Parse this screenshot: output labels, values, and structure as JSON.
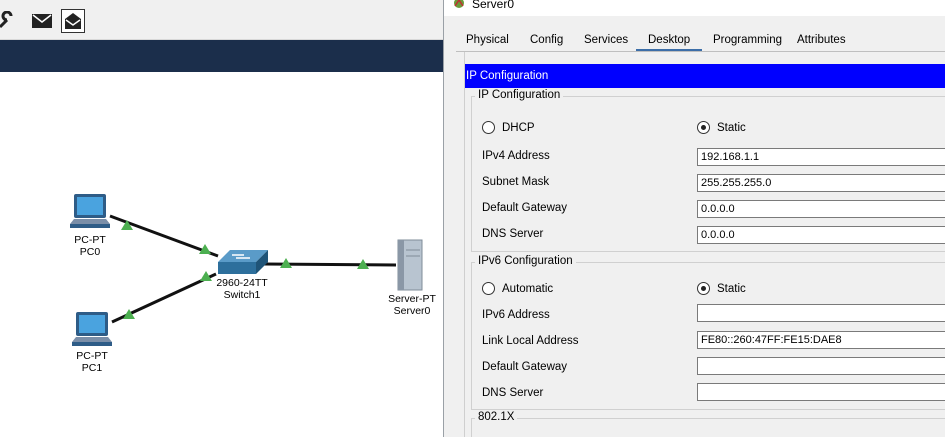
{
  "workspace": {
    "devices": [
      {
        "type": "PC-PT",
        "name": "PC0"
      },
      {
        "type": "PC-PT",
        "name": "PC1"
      },
      {
        "type": "2960-24TT",
        "name": "Switch1"
      },
      {
        "type": "Server-PT",
        "name": "Server0"
      }
    ]
  },
  "window": {
    "title": "Server0",
    "tabs": [
      {
        "label": "Physical",
        "active": false
      },
      {
        "label": "Config",
        "active": false
      },
      {
        "label": "Services",
        "active": false
      },
      {
        "label": "Desktop",
        "active": true
      },
      {
        "label": "Programming",
        "active": false
      },
      {
        "label": "Attributes",
        "active": false
      }
    ],
    "section_header": "IP Configuration",
    "ipv4": {
      "title": "IP Configuration",
      "dhcp_label": "DHCP",
      "static_label": "Static",
      "mode": "static",
      "ipv4_label": "IPv4 Address",
      "ipv4_value": "192.168.1.1",
      "mask_label": "Subnet Mask",
      "mask_value": "255.255.255.0",
      "gateway_label": "Default Gateway",
      "gateway_value": "0.0.0.0",
      "dns_label": "DNS Server",
      "dns_value": "0.0.0.0"
    },
    "ipv6": {
      "title": "IPv6 Configuration",
      "auto_label": "Automatic",
      "static_label": "Static",
      "mode": "static",
      "address_label": "IPv6 Address",
      "address_value": "",
      "linklocal_label": "Link Local Address",
      "linklocal_value": "FE80::260:47FF:FE15:DAE8",
      "gateway_label": "Default Gateway",
      "gateway_value": "",
      "dns_label": "DNS Server",
      "dns_value": ""
    },
    "dot1x_title": "802.1X"
  },
  "colors": {
    "header_blue": "#0000ff",
    "link_green": "#5cb85c",
    "topbar_dark": "#1b2e4b"
  }
}
